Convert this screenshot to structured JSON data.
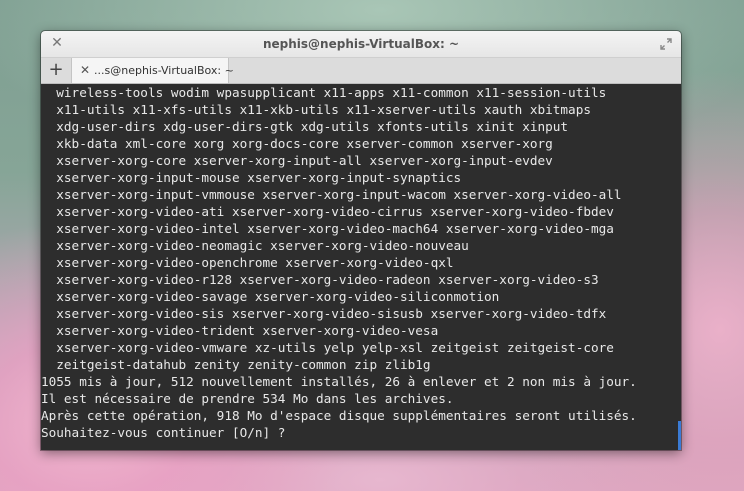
{
  "window": {
    "title": "nephis@nephis-VirtualBox: ~",
    "close_glyph": "✕",
    "add_tab_glyph": "+"
  },
  "tab": {
    "label": "...s@nephis-VirtualBox: ~",
    "close_glyph": "✕"
  },
  "terminal": {
    "lines": [
      "  wireless-tools wodim wpasupplicant x11-apps x11-common x11-session-utils",
      "  x11-utils x11-xfs-utils x11-xkb-utils x11-xserver-utils xauth xbitmaps",
      "  xdg-user-dirs xdg-user-dirs-gtk xdg-utils xfonts-utils xinit xinput",
      "  xkb-data xml-core xorg xorg-docs-core xserver-common xserver-xorg",
      "  xserver-xorg-core xserver-xorg-input-all xserver-xorg-input-evdev",
      "  xserver-xorg-input-mouse xserver-xorg-input-synaptics",
      "  xserver-xorg-input-vmmouse xserver-xorg-input-wacom xserver-xorg-video-all",
      "  xserver-xorg-video-ati xserver-xorg-video-cirrus xserver-xorg-video-fbdev",
      "  xserver-xorg-video-intel xserver-xorg-video-mach64 xserver-xorg-video-mga",
      "  xserver-xorg-video-neomagic xserver-xorg-video-nouveau",
      "  xserver-xorg-video-openchrome xserver-xorg-video-qxl",
      "  xserver-xorg-video-r128 xserver-xorg-video-radeon xserver-xorg-video-s3",
      "  xserver-xorg-video-savage xserver-xorg-video-siliconmotion",
      "  xserver-xorg-video-sis xserver-xorg-video-sisusb xserver-xorg-video-tdfx",
      "  xserver-xorg-video-trident xserver-xorg-video-vesa",
      "  xserver-xorg-video-vmware xz-utils yelp yelp-xsl zeitgeist zeitgeist-core",
      "  zeitgeist-datahub zenity zenity-common zip zlib1g",
      "1055 mis à jour, 512 nouvellement installés, 26 à enlever et 2 non mis à jour.",
      "Il est nécessaire de prendre 534 Mo dans les archives.",
      "Après cette opération, 918 Mo d'espace disque supplémentaires seront utilisés.",
      "Souhaitez-vous continuer [O/n] ? "
    ]
  },
  "colors": {
    "terminal_bg": "#2d2d2d",
    "terminal_fg": "#e8e8e8",
    "accent": "#3a7bd5"
  }
}
